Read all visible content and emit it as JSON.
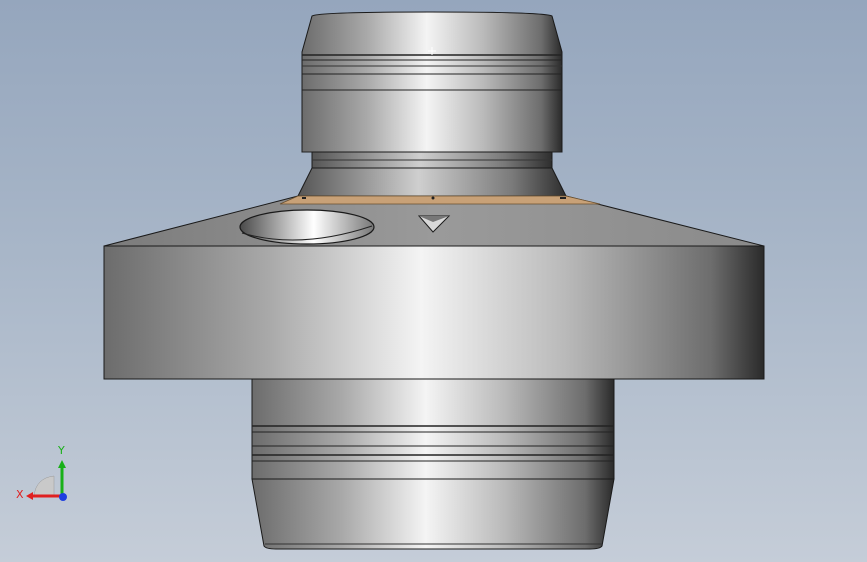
{
  "viewport": {
    "background_top": "#95a6bd",
    "background_bottom": "#c5cdd8"
  },
  "model": {
    "shaded_color": "#9b9b9b",
    "highlight_color": "#f4f4f4",
    "face_accent_color": "#c8a177",
    "edge_color": "#1a1a1a"
  },
  "triad": {
    "x_label": "X",
    "y_label": "Y",
    "x_color": "#e02020",
    "y_color": "#18b018",
    "z_color": "#1f3fe0"
  }
}
